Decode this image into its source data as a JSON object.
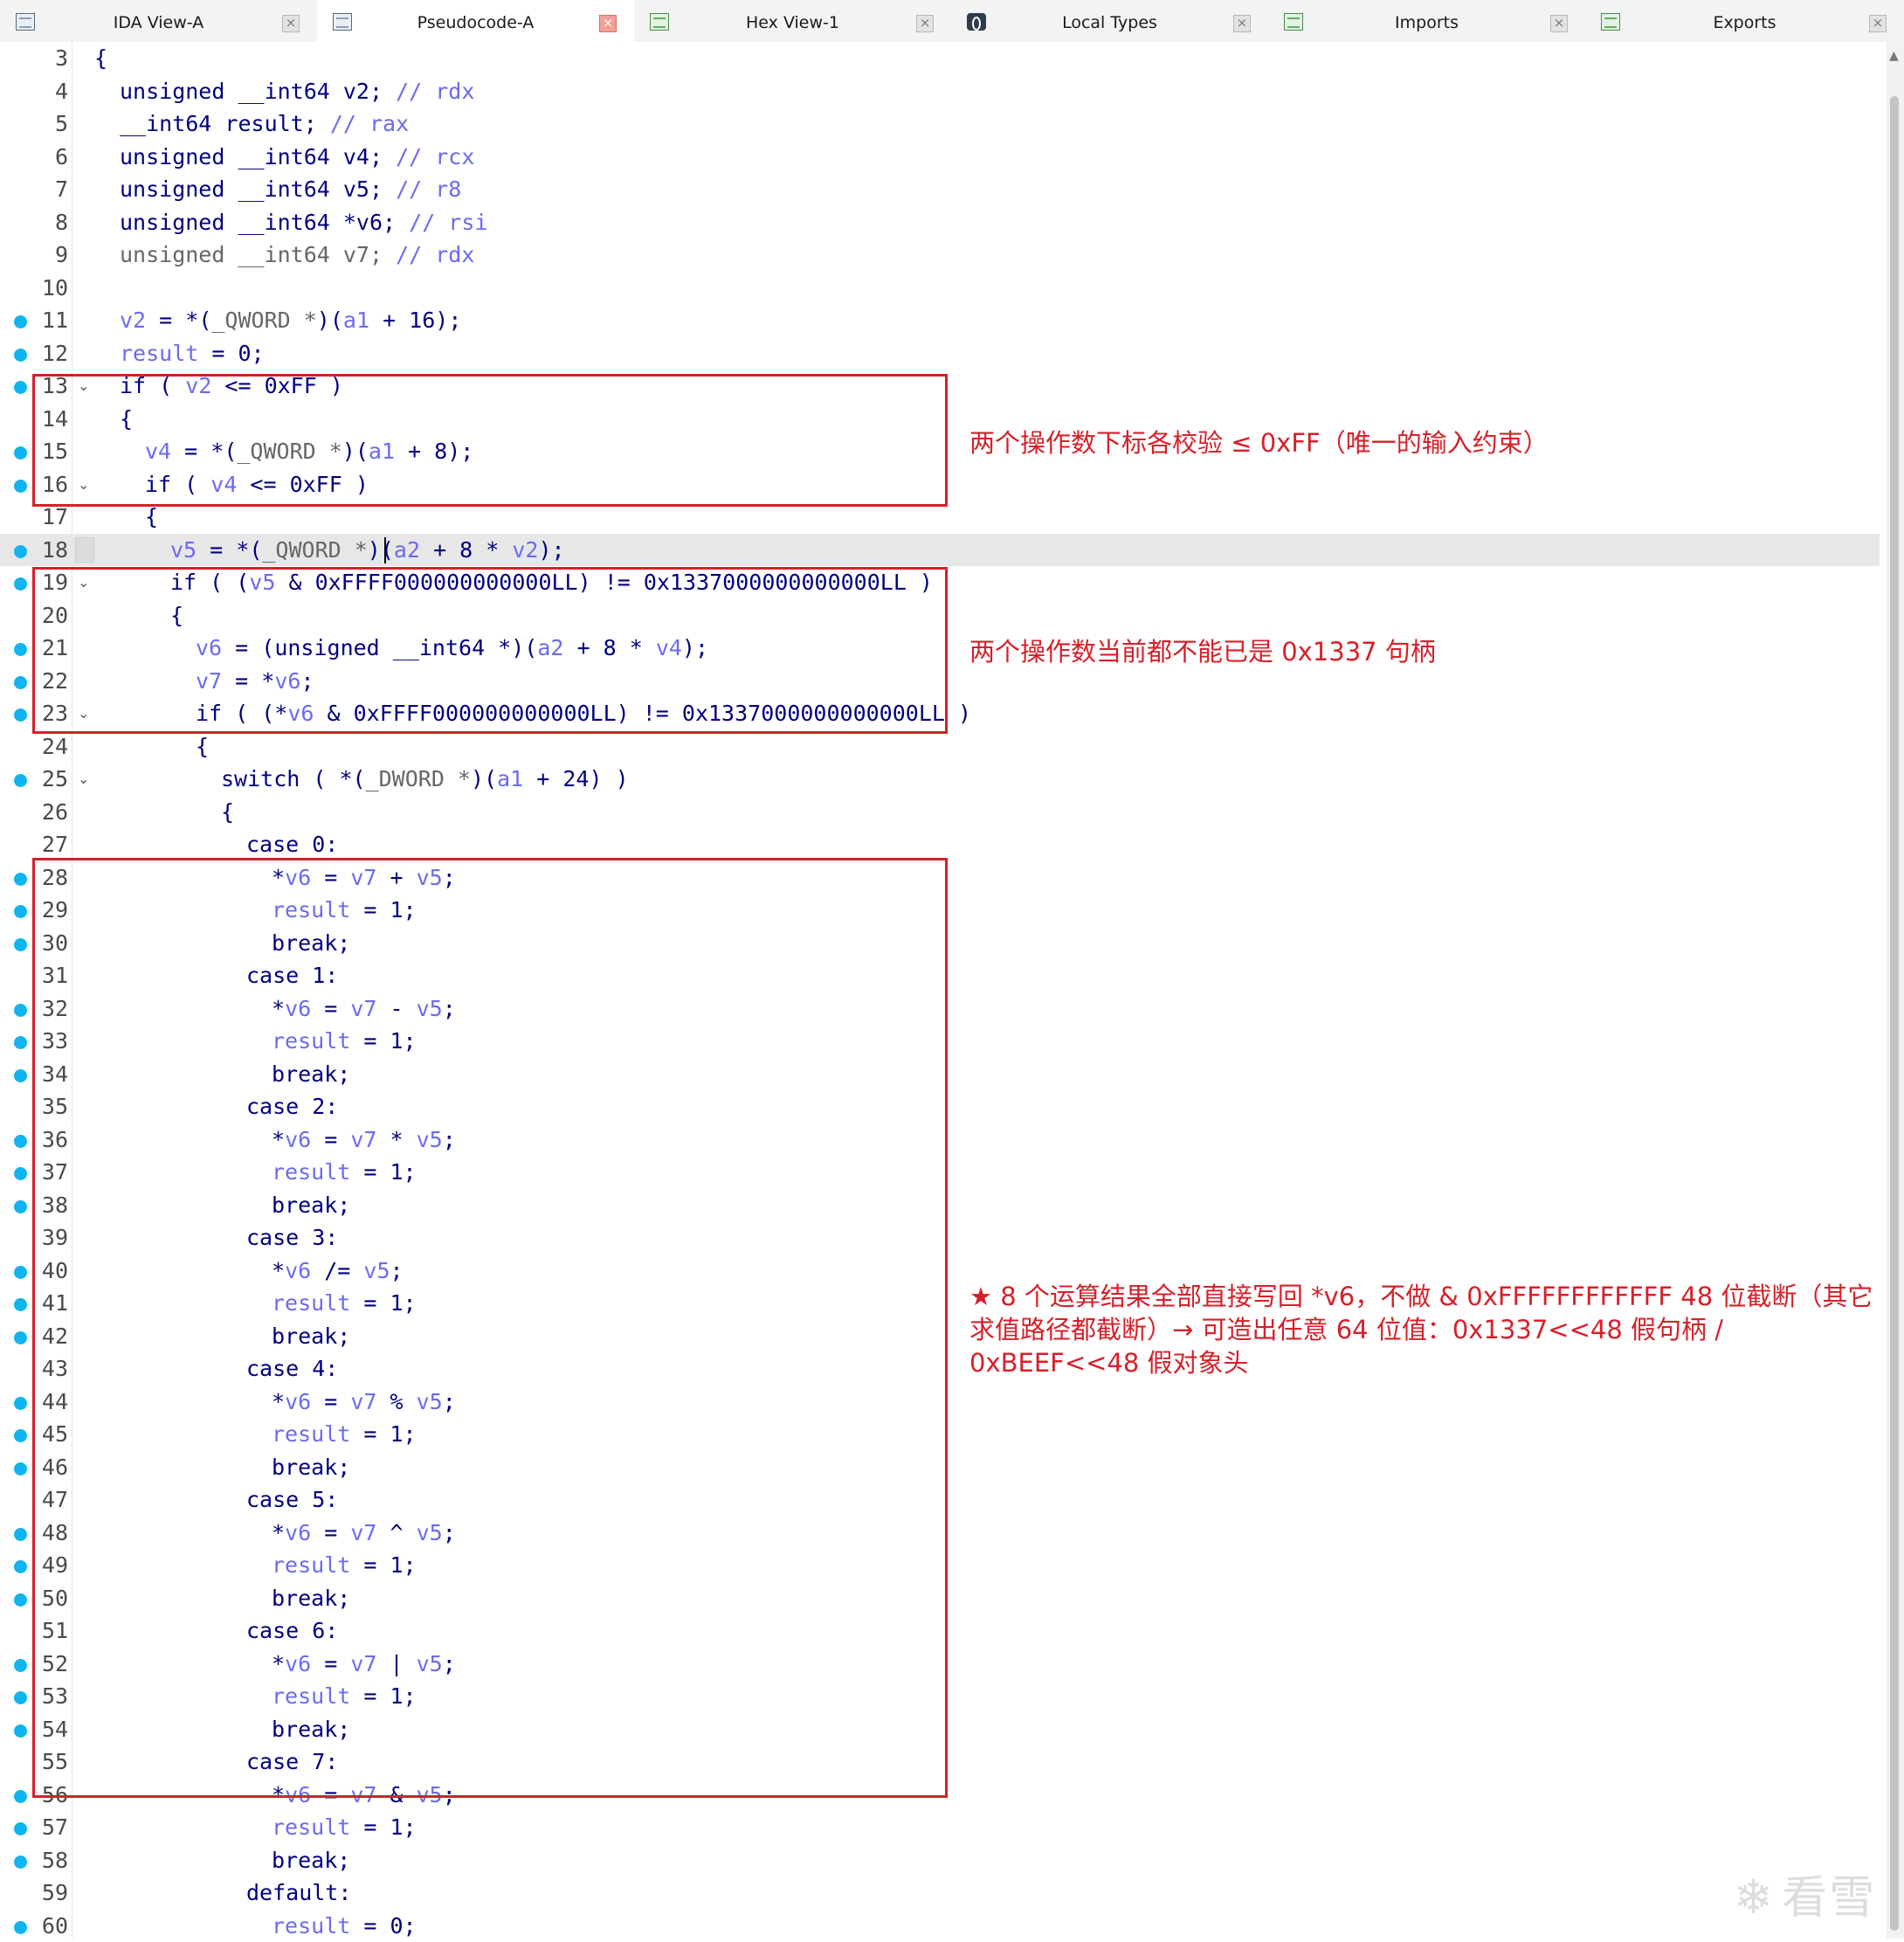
{
  "tabs": [
    {
      "label": "IDA View-A",
      "icon": "ida-view-icon",
      "active": false
    },
    {
      "label": "Pseudocode-A",
      "icon": "pseudocode-icon",
      "active": true
    },
    {
      "label": "Hex View-1",
      "icon": "hex-view-icon",
      "active": false
    },
    {
      "label": "Local Types",
      "icon": "local-types-icon",
      "active": false
    },
    {
      "label": "Imports",
      "icon": "imports-icon",
      "active": false
    },
    {
      "label": "Exports",
      "icon": "exports-icon",
      "active": false
    }
  ],
  "tab_close_glyph": "×",
  "colors": {
    "keyword": "#000080",
    "variable": "#6b6bf0",
    "comment": "#6b6bf0",
    "type_gray": "#666666",
    "annotation_red": "#d6202a",
    "breakpoint_blue": "#10b5ef"
  },
  "code_lines": [
    {
      "num": "3",
      "bp": false,
      "fold": false,
      "indent": 0,
      "tokens": [
        {
          "t": "{",
          "c": "k"
        }
      ]
    },
    {
      "num": "4",
      "bp": false,
      "fold": false,
      "indent": 1,
      "tokens": [
        {
          "t": "unsigned __int64 v2; ",
          "c": "k"
        },
        {
          "t": "// rdx",
          "c": "v"
        }
      ]
    },
    {
      "num": "5",
      "bp": false,
      "fold": false,
      "indent": 1,
      "tokens": [
        {
          "t": "__int64 result; ",
          "c": "k"
        },
        {
          "t": "// rax",
          "c": "v"
        }
      ]
    },
    {
      "num": "6",
      "bp": false,
      "fold": false,
      "indent": 1,
      "tokens": [
        {
          "t": "unsigned __int64 v4; ",
          "c": "k"
        },
        {
          "t": "// rcx",
          "c": "v"
        }
      ]
    },
    {
      "num": "7",
      "bp": false,
      "fold": false,
      "indent": 1,
      "tokens": [
        {
          "t": "unsigned __int64 v5; ",
          "c": "k"
        },
        {
          "t": "// r8",
          "c": "v"
        }
      ]
    },
    {
      "num": "8",
      "bp": false,
      "fold": false,
      "indent": 1,
      "tokens": [
        {
          "t": "unsigned __int64 *v6; ",
          "c": "k"
        },
        {
          "t": "// rsi",
          "c": "v"
        }
      ]
    },
    {
      "num": "9",
      "bp": false,
      "fold": false,
      "indent": 1,
      "tokens": [
        {
          "t": "unsigned __int64 v7; ",
          "c": "g"
        },
        {
          "t": "// rdx",
          "c": "v"
        }
      ]
    },
    {
      "num": "10",
      "bp": false,
      "fold": false,
      "indent": 0,
      "tokens": []
    },
    {
      "num": "11",
      "bp": true,
      "fold": false,
      "indent": 1,
      "tokens": [
        {
          "t": "v2",
          "c": "v"
        },
        {
          "t": " = *(",
          "c": "k"
        },
        {
          "t": "_QWORD *",
          "c": "g"
        },
        {
          "t": ")(",
          "c": "k"
        },
        {
          "t": "a1",
          "c": "v"
        },
        {
          "t": " + 16);",
          "c": "k"
        }
      ]
    },
    {
      "num": "12",
      "bp": true,
      "fold": false,
      "indent": 1,
      "tokens": [
        {
          "t": "result",
          "c": "v"
        },
        {
          "t": " = 0;",
          "c": "k"
        }
      ]
    },
    {
      "num": "13",
      "bp": true,
      "fold": true,
      "indent": 1,
      "tokens": [
        {
          "t": "if ( ",
          "c": "k"
        },
        {
          "t": "v2",
          "c": "v"
        },
        {
          "t": " <= 0xFF )",
          "c": "k"
        }
      ]
    },
    {
      "num": "14",
      "bp": false,
      "fold": false,
      "indent": 1,
      "tokens": [
        {
          "t": "{",
          "c": "k"
        }
      ]
    },
    {
      "num": "15",
      "bp": true,
      "fold": false,
      "indent": 2,
      "tokens": [
        {
          "t": "v4",
          "c": "v"
        },
        {
          "t": " = *(",
          "c": "k"
        },
        {
          "t": "_QWORD *",
          "c": "g"
        },
        {
          "t": ")(",
          "c": "k"
        },
        {
          "t": "a1",
          "c": "v"
        },
        {
          "t": " + 8);",
          "c": "k"
        }
      ]
    },
    {
      "num": "16",
      "bp": true,
      "fold": true,
      "indent": 2,
      "tokens": [
        {
          "t": "if ( ",
          "c": "k"
        },
        {
          "t": "v4",
          "c": "v"
        },
        {
          "t": " <= 0xFF )",
          "c": "k"
        }
      ]
    },
    {
      "num": "17",
      "bp": false,
      "fold": false,
      "indent": 2,
      "tokens": [
        {
          "t": "{",
          "c": "k"
        }
      ]
    },
    {
      "num": "18",
      "bp": true,
      "fold": false,
      "indent": 3,
      "hl": true,
      "tokens": [
        {
          "t": "v5",
          "c": "v"
        },
        {
          "t": " = *(",
          "c": "k"
        },
        {
          "t": "_QWORD *",
          "c": "g"
        },
        {
          "t": ")(",
          "c": "k"
        },
        {
          "t": "a2",
          "c": "v"
        },
        {
          "t": " + 8 * ",
          "c": "k"
        },
        {
          "t": "v2",
          "c": "v"
        },
        {
          "t": ");",
          "c": "k"
        }
      ]
    },
    {
      "num": "19",
      "bp": true,
      "fold": true,
      "indent": 3,
      "tokens": [
        {
          "t": "if ( (",
          "c": "k"
        },
        {
          "t": "v5",
          "c": "v"
        },
        {
          "t": " & 0xFFFF000000000000LL) != 0x1337000000000000LL )",
          "c": "k"
        }
      ]
    },
    {
      "num": "20",
      "bp": false,
      "fold": false,
      "indent": 3,
      "tokens": [
        {
          "t": "{",
          "c": "k"
        }
      ]
    },
    {
      "num": "21",
      "bp": true,
      "fold": false,
      "indent": 4,
      "tokens": [
        {
          "t": "v6",
          "c": "v"
        },
        {
          "t": " = (unsigned __int64 *)(",
          "c": "k"
        },
        {
          "t": "a2",
          "c": "v"
        },
        {
          "t": " + 8 * ",
          "c": "k"
        },
        {
          "t": "v4",
          "c": "v"
        },
        {
          "t": ");",
          "c": "k"
        }
      ]
    },
    {
      "num": "22",
      "bp": true,
      "fold": false,
      "indent": 4,
      "tokens": [
        {
          "t": "v7",
          "c": "v"
        },
        {
          "t": " = *",
          "c": "k"
        },
        {
          "t": "v6",
          "c": "v"
        },
        {
          "t": ";",
          "c": "k"
        }
      ]
    },
    {
      "num": "23",
      "bp": true,
      "fold": true,
      "indent": 4,
      "tokens": [
        {
          "t": "if ( (*",
          "c": "k"
        },
        {
          "t": "v6",
          "c": "v"
        },
        {
          "t": " & 0xFFFF000000000000LL) != 0x1337000000000000LL )",
          "c": "k"
        }
      ]
    },
    {
      "num": "24",
      "bp": false,
      "fold": false,
      "indent": 4,
      "tokens": [
        {
          "t": "{",
          "c": "k"
        }
      ]
    },
    {
      "num": "25",
      "bp": true,
      "fold": true,
      "indent": 5,
      "tokens": [
        {
          "t": "switch ( *(",
          "c": "k"
        },
        {
          "t": "_DWORD *",
          "c": "g"
        },
        {
          "t": ")(",
          "c": "k"
        },
        {
          "t": "a1",
          "c": "v"
        },
        {
          "t": " + 24) )",
          "c": "k"
        }
      ]
    },
    {
      "num": "26",
      "bp": false,
      "fold": false,
      "indent": 5,
      "tokens": [
        {
          "t": "{",
          "c": "k"
        }
      ]
    },
    {
      "num": "27",
      "bp": false,
      "fold": false,
      "indent": 6,
      "tokens": [
        {
          "t": "case 0:",
          "c": "k"
        }
      ]
    },
    {
      "num": "28",
      "bp": true,
      "fold": false,
      "indent": 7,
      "tokens": [
        {
          "t": "*",
          "c": "k"
        },
        {
          "t": "v6",
          "c": "v"
        },
        {
          "t": " = ",
          "c": "k"
        },
        {
          "t": "v7",
          "c": "v"
        },
        {
          "t": " + ",
          "c": "k"
        },
        {
          "t": "v5",
          "c": "v"
        },
        {
          "t": ";",
          "c": "k"
        }
      ]
    },
    {
      "num": "29",
      "bp": true,
      "fold": false,
      "indent": 7,
      "tokens": [
        {
          "t": "result",
          "c": "v"
        },
        {
          "t": " = 1;",
          "c": "k"
        }
      ]
    },
    {
      "num": "30",
      "bp": true,
      "fold": false,
      "indent": 7,
      "tokens": [
        {
          "t": "break;",
          "c": "k"
        }
      ]
    },
    {
      "num": "31",
      "bp": false,
      "fold": false,
      "indent": 6,
      "tokens": [
        {
          "t": "case 1:",
          "c": "k"
        }
      ]
    },
    {
      "num": "32",
      "bp": true,
      "fold": false,
      "indent": 7,
      "tokens": [
        {
          "t": "*",
          "c": "k"
        },
        {
          "t": "v6",
          "c": "v"
        },
        {
          "t": " = ",
          "c": "k"
        },
        {
          "t": "v7",
          "c": "v"
        },
        {
          "t": " - ",
          "c": "k"
        },
        {
          "t": "v5",
          "c": "v"
        },
        {
          "t": ";",
          "c": "k"
        }
      ]
    },
    {
      "num": "33",
      "bp": true,
      "fold": false,
      "indent": 7,
      "tokens": [
        {
          "t": "result",
          "c": "v"
        },
        {
          "t": " = 1;",
          "c": "k"
        }
      ]
    },
    {
      "num": "34",
      "bp": true,
      "fold": false,
      "indent": 7,
      "tokens": [
        {
          "t": "break;",
          "c": "k"
        }
      ]
    },
    {
      "num": "35",
      "bp": false,
      "fold": false,
      "indent": 6,
      "tokens": [
        {
          "t": "case 2:",
          "c": "k"
        }
      ]
    },
    {
      "num": "36",
      "bp": true,
      "fold": false,
      "indent": 7,
      "tokens": [
        {
          "t": "*",
          "c": "k"
        },
        {
          "t": "v6",
          "c": "v"
        },
        {
          "t": " = ",
          "c": "k"
        },
        {
          "t": "v7",
          "c": "v"
        },
        {
          "t": " * ",
          "c": "k"
        },
        {
          "t": "v5",
          "c": "v"
        },
        {
          "t": ";",
          "c": "k"
        }
      ]
    },
    {
      "num": "37",
      "bp": true,
      "fold": false,
      "indent": 7,
      "tokens": [
        {
          "t": "result",
          "c": "v"
        },
        {
          "t": " = 1;",
          "c": "k"
        }
      ]
    },
    {
      "num": "38",
      "bp": true,
      "fold": false,
      "indent": 7,
      "tokens": [
        {
          "t": "break;",
          "c": "k"
        }
      ]
    },
    {
      "num": "39",
      "bp": false,
      "fold": false,
      "indent": 6,
      "tokens": [
        {
          "t": "case 3:",
          "c": "k"
        }
      ]
    },
    {
      "num": "40",
      "bp": true,
      "fold": false,
      "indent": 7,
      "tokens": [
        {
          "t": "*",
          "c": "k"
        },
        {
          "t": "v6",
          "c": "v"
        },
        {
          "t": " /= ",
          "c": "k"
        },
        {
          "t": "v5",
          "c": "v"
        },
        {
          "t": ";",
          "c": "k"
        }
      ]
    },
    {
      "num": "41",
      "bp": true,
      "fold": false,
      "indent": 7,
      "tokens": [
        {
          "t": "result",
          "c": "v"
        },
        {
          "t": " = 1;",
          "c": "k"
        }
      ]
    },
    {
      "num": "42",
      "bp": true,
      "fold": false,
      "indent": 7,
      "tokens": [
        {
          "t": "break;",
          "c": "k"
        }
      ]
    },
    {
      "num": "43",
      "bp": false,
      "fold": false,
      "indent": 6,
      "tokens": [
        {
          "t": "case 4:",
          "c": "k"
        }
      ]
    },
    {
      "num": "44",
      "bp": true,
      "fold": false,
      "indent": 7,
      "tokens": [
        {
          "t": "*",
          "c": "k"
        },
        {
          "t": "v6",
          "c": "v"
        },
        {
          "t": " = ",
          "c": "k"
        },
        {
          "t": "v7",
          "c": "v"
        },
        {
          "t": " % ",
          "c": "k"
        },
        {
          "t": "v5",
          "c": "v"
        },
        {
          "t": ";",
          "c": "k"
        }
      ]
    },
    {
      "num": "45",
      "bp": true,
      "fold": false,
      "indent": 7,
      "tokens": [
        {
          "t": "result",
          "c": "v"
        },
        {
          "t": " = 1;",
          "c": "k"
        }
      ]
    },
    {
      "num": "46",
      "bp": true,
      "fold": false,
      "indent": 7,
      "tokens": [
        {
          "t": "break;",
          "c": "k"
        }
      ]
    },
    {
      "num": "47",
      "bp": false,
      "fold": false,
      "indent": 6,
      "tokens": [
        {
          "t": "case 5:",
          "c": "k"
        }
      ]
    },
    {
      "num": "48",
      "bp": true,
      "fold": false,
      "indent": 7,
      "tokens": [
        {
          "t": "*",
          "c": "k"
        },
        {
          "t": "v6",
          "c": "v"
        },
        {
          "t": " = ",
          "c": "k"
        },
        {
          "t": "v7",
          "c": "v"
        },
        {
          "t": " ^ ",
          "c": "k"
        },
        {
          "t": "v5",
          "c": "v"
        },
        {
          "t": ";",
          "c": "k"
        }
      ]
    },
    {
      "num": "49",
      "bp": true,
      "fold": false,
      "indent": 7,
      "tokens": [
        {
          "t": "result",
          "c": "v"
        },
        {
          "t": " = 1;",
          "c": "k"
        }
      ]
    },
    {
      "num": "50",
      "bp": true,
      "fold": false,
      "indent": 7,
      "tokens": [
        {
          "t": "break;",
          "c": "k"
        }
      ]
    },
    {
      "num": "51",
      "bp": false,
      "fold": false,
      "indent": 6,
      "tokens": [
        {
          "t": "case 6:",
          "c": "k"
        }
      ]
    },
    {
      "num": "52",
      "bp": true,
      "fold": false,
      "indent": 7,
      "tokens": [
        {
          "t": "*",
          "c": "k"
        },
        {
          "t": "v6",
          "c": "v"
        },
        {
          "t": " = ",
          "c": "k"
        },
        {
          "t": "v7",
          "c": "v"
        },
        {
          "t": " | ",
          "c": "k"
        },
        {
          "t": "v5",
          "c": "v"
        },
        {
          "t": ";",
          "c": "k"
        }
      ]
    },
    {
      "num": "53",
      "bp": true,
      "fold": false,
      "indent": 7,
      "tokens": [
        {
          "t": "result",
          "c": "v"
        },
        {
          "t": " = 1;",
          "c": "k"
        }
      ]
    },
    {
      "num": "54",
      "bp": true,
      "fold": false,
      "indent": 7,
      "tokens": [
        {
          "t": "break;",
          "c": "k"
        }
      ]
    },
    {
      "num": "55",
      "bp": false,
      "fold": false,
      "indent": 6,
      "tokens": [
        {
          "t": "case 7:",
          "c": "k"
        }
      ]
    },
    {
      "num": "56",
      "bp": true,
      "fold": false,
      "indent": 7,
      "tokens": [
        {
          "t": "*",
          "c": "k"
        },
        {
          "t": "v6",
          "c": "v"
        },
        {
          "t": " = ",
          "c": "k"
        },
        {
          "t": "v7",
          "c": "v"
        },
        {
          "t": " & ",
          "c": "k"
        },
        {
          "t": "v5",
          "c": "v"
        },
        {
          "t": ";",
          "c": "k"
        }
      ]
    },
    {
      "num": "57",
      "bp": true,
      "fold": false,
      "indent": 7,
      "tokens": [
        {
          "t": "result",
          "c": "v"
        },
        {
          "t": " = 1;",
          "c": "k"
        }
      ]
    },
    {
      "num": "58",
      "bp": true,
      "fold": false,
      "indent": 7,
      "tokens": [
        {
          "t": "break;",
          "c": "k"
        }
      ]
    },
    {
      "num": "59",
      "bp": false,
      "fold": false,
      "indent": 6,
      "tokens": [
        {
          "t": "default:",
          "c": "k"
        }
      ]
    },
    {
      "num": "60",
      "bp": true,
      "fold": false,
      "indent": 7,
      "tokens": [
        {
          "t": "result",
          "c": "v"
        },
        {
          "t": " = 0;",
          "c": "k"
        }
      ]
    }
  ],
  "annotations": [
    {
      "text": "两个操作数下标各校验 ≤ 0xFF（唯一的输入约束）"
    },
    {
      "text": "两个操作数当前都不能已是 0x1337 句柄"
    },
    {
      "text": "★ 8 个运算结果全部直接写回 *v6，不做 & 0xFFFFFFFFFFFF 48 位截断（其它求值路径都截断）→ 可造出任意 64 位值：0x1337<<48 假句柄 / 0xBEEF<<48 假对象头"
    }
  ],
  "watermark": "看雪"
}
